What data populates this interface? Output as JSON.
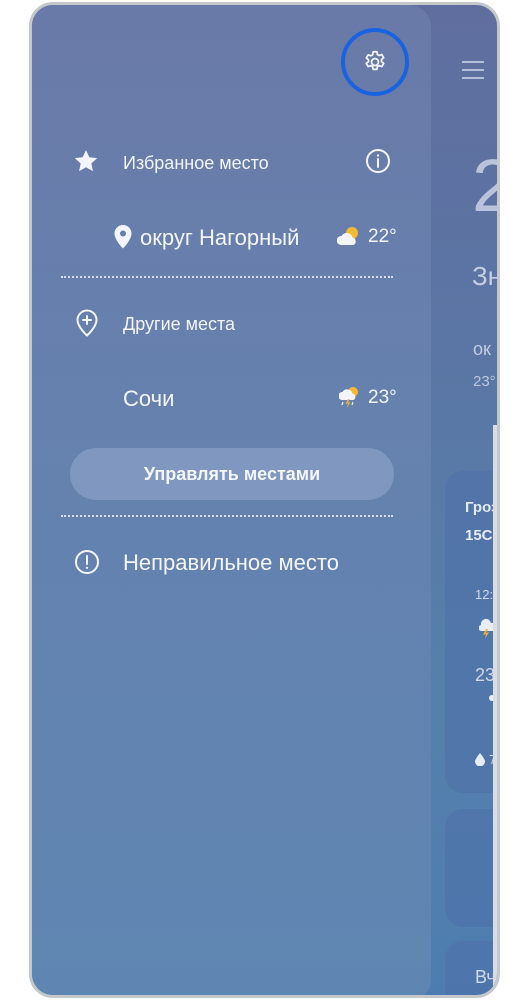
{
  "drawer": {
    "settings_icon": "gear-icon",
    "favorites": {
      "section_label": "Избранное место",
      "info_icon": "info-icon",
      "location": {
        "name": "округ Нагорный",
        "weather_icon": "partly-cloudy-icon",
        "temperature": "22°"
      }
    },
    "other": {
      "section_label": "Другие места",
      "location": {
        "name": "Сочи",
        "weather_icon": "thunderstorm-icon",
        "temperature": "23°"
      }
    },
    "manage_button_label": "Управлять местами",
    "wrong_location_label": "Неправильное место"
  },
  "background": {
    "big_temp": "2",
    "subtitle": "Зн",
    "line1": "ок",
    "line2": "23°",
    "card1_title": "Гроз",
    "card1_subtitle": "15С",
    "card1_time": "12:",
    "card1_temp": "23",
    "card1_precip": "7",
    "card3_title": "Вч"
  },
  "colors": {
    "highlight_ring": "#1a63e0",
    "drawer_top": "#6a7aa8",
    "drawer_bottom": "#5f86b2"
  }
}
